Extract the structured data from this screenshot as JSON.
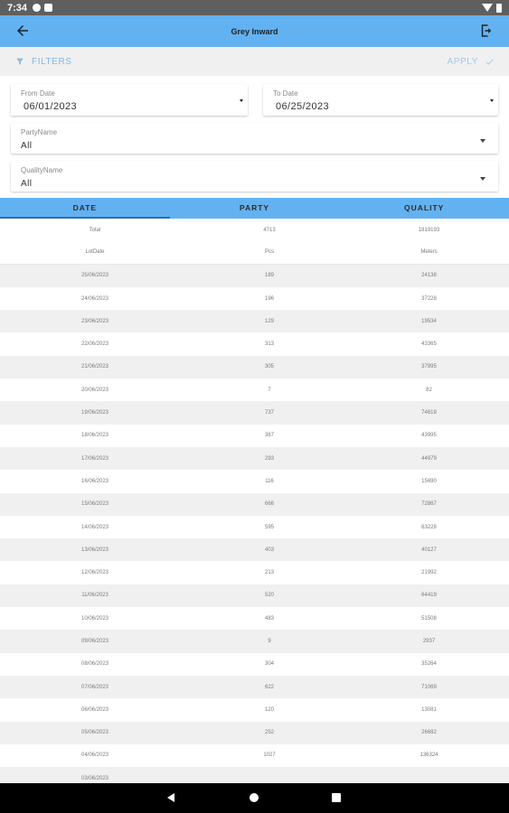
{
  "status_bar": {
    "time": "7:34"
  },
  "app_bar": {
    "title": "Grey Inward"
  },
  "filter_bar": {
    "filters_label": "FILTERS",
    "apply_label": "APPLY"
  },
  "form": {
    "from_date": {
      "label": "From Date",
      "value": "06/01/2023"
    },
    "to_date": {
      "label": "To Date",
      "value": "06/25/2023"
    },
    "party": {
      "label": "PartyName",
      "value": "All"
    },
    "quality": {
      "label": "QualityName",
      "value": "All"
    }
  },
  "tabs": [
    {
      "label": "DATE"
    },
    {
      "label": "PARTY"
    },
    {
      "label": "QUALITY"
    }
  ],
  "table": {
    "total_row": [
      "Total",
      "4713",
      "1819193"
    ],
    "header_row": [
      "LotDate",
      "Pcs",
      "Meters"
    ],
    "rows": [
      [
        "25/06/2023",
        "189",
        "24138"
      ],
      [
        "24/06/2023",
        "196",
        "37228"
      ],
      [
        "23/06/2023",
        "129",
        "19534"
      ],
      [
        "22/06/2023",
        "313",
        "43365"
      ],
      [
        "21/06/2023",
        "305",
        "37995"
      ],
      [
        "20/06/2023",
        "7",
        "82"
      ],
      [
        "19/06/2023",
        "737",
        "74619"
      ],
      [
        "18/06/2023",
        "367",
        "43995"
      ],
      [
        "17/06/2023",
        "293",
        "44979"
      ],
      [
        "16/06/2023",
        "116",
        "15690"
      ],
      [
        "15/06/2023",
        "666",
        "72867"
      ],
      [
        "14/06/2023",
        "595",
        "63228"
      ],
      [
        "13/06/2023",
        "403",
        "40127"
      ],
      [
        "12/06/2023",
        "213",
        "21992"
      ],
      [
        "11/06/2023",
        "520",
        "64419"
      ],
      [
        "10/06/2023",
        "483",
        "51508"
      ],
      [
        "09/06/2023",
        "9",
        "2937"
      ],
      [
        "08/06/2023",
        "304",
        "35264"
      ],
      [
        "07/06/2023",
        "622",
        "71069"
      ],
      [
        "06/06/2023",
        "120",
        "13081"
      ],
      [
        "05/06/2023",
        "252",
        "26682"
      ],
      [
        "04/06/2023",
        "1027",
        "136324"
      ],
      [
        "03/06/2023",
        "",
        ""
      ]
    ]
  },
  "colors": {
    "primary": "#62b2f2",
    "tab_indicator": "#2a6fa8",
    "row_alt": "#f0f0f0"
  }
}
